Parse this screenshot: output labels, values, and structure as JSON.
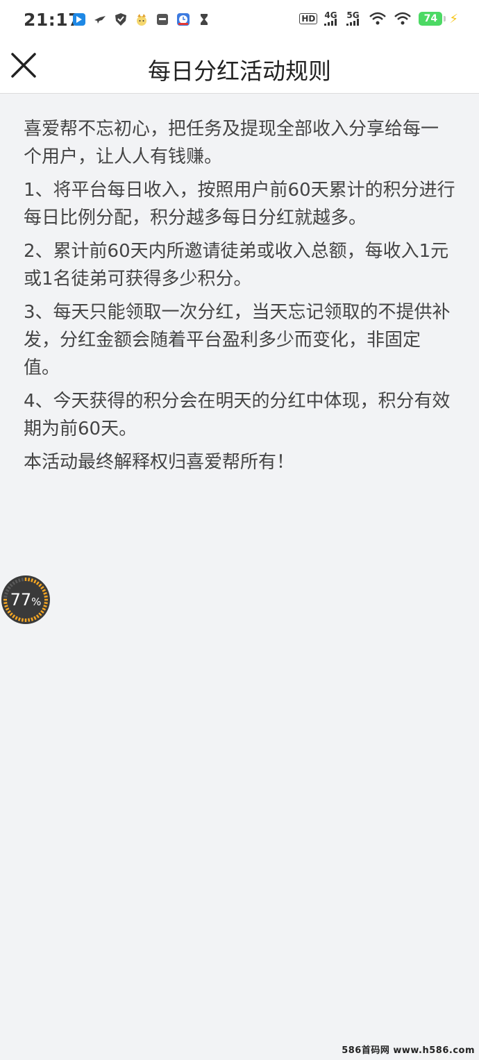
{
  "status_bar": {
    "time": "21:17",
    "network_1": "4G",
    "network_2": "5G",
    "hd_label": "HD",
    "battery": "74",
    "icons": [
      "signal-app-icon",
      "bird-icon",
      "shield-icon",
      "cat-icon",
      "box-icon",
      "clock-app-icon",
      "hourglass-icon"
    ]
  },
  "nav": {
    "title": "每日分红活动规则",
    "close_icon": "close-icon"
  },
  "rules": {
    "intro": "喜爱帮不忘初心，把任务及提现全部收入分享给每一个用户，让人人有钱赚。",
    "items": [
      "1、将平台每日收入，按照用户前60天累计的积分进行每日比例分配，积分越多每日分红就越多。",
      "2、累计前60天内所邀请徒弟或收入总额，每收入1元或1名徒弟可获得多少积分。",
      "3、每天只能领取一次分红，当天忘记领取的不提供补发，分红金额会随着平台盈利多少而变化，非固定值。",
      "4、今天获得的积分会在明天的分红中体现，积分有效期为前60天。"
    ],
    "footer": "本活动最终解释权归喜爱帮所有！"
  },
  "progress_widget": {
    "value": "77",
    "unit": "%",
    "fraction": 0.77,
    "accent": "#f5a623"
  },
  "watermark": "586首码网 www.h586.com"
}
